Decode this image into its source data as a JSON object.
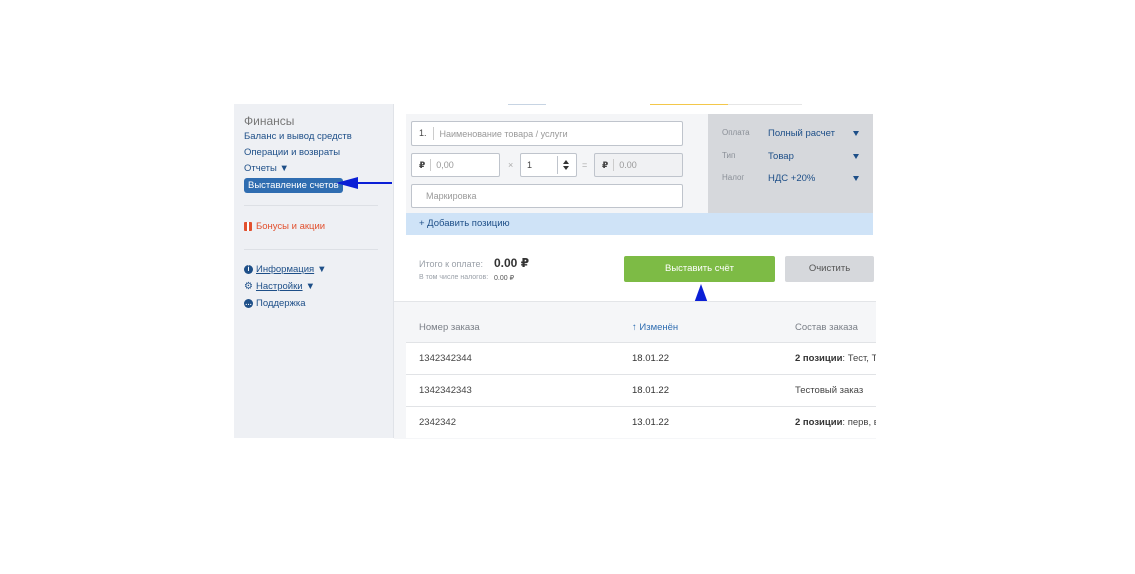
{
  "sidebar": {
    "title": "Финансы",
    "links": [
      {
        "label": "Баланс и вывод средств"
      },
      {
        "label": "Операции и возвраты"
      },
      {
        "label": "Отчеты ▼"
      }
    ],
    "active": "Выставление счетов",
    "bonus": "Бонусы и акции",
    "info": "Информация",
    "settings": "Настройки",
    "support": "Поддержка",
    "caret": "▼"
  },
  "form": {
    "item_number": "1.",
    "name_placeholder": "Наименование товара / услуги",
    "currency": "₽",
    "price_placeholder": "0,00",
    "times": "×",
    "qty": "1",
    "equals": "=",
    "total_value": "0.00",
    "marking_placeholder": "Маркировка",
    "add_position": "+ Добавить позицию"
  },
  "options": {
    "payment_label": "Оплата",
    "payment_value": "Полный расчет",
    "type_label": "Тип",
    "type_value": "Товар",
    "tax_label": "Налог",
    "tax_value": "НДС +20%"
  },
  "summary": {
    "total_label": "Итого к оплате:",
    "total_value": "0.00 ₽",
    "tax_label": "В том числе налогов:",
    "tax_value": "0.00 ₽"
  },
  "actions": {
    "issue": "Выставить счёт",
    "clear": "Очистить"
  },
  "table": {
    "headers": [
      "Номер заказа",
      "↑ Изменён",
      "Состав заказа"
    ],
    "rows": [
      {
        "order": "1342342344",
        "date": "18.01.22",
        "comp_bold": "2 позиции",
        "comp_rest": ": Тест, Тест"
      },
      {
        "order": "1342342343",
        "date": "18.01.22",
        "comp_bold": "",
        "comp_rest": "Тестовый заказ"
      },
      {
        "order": "2342342",
        "date": "13.01.22",
        "comp_bold": "2 позиции",
        "comp_rest": ": перв, вто"
      }
    ]
  },
  "colors": {
    "accent_blue": "#2f6db1",
    "link_blue": "#1e4f88",
    "issue_green": "#7dbb45",
    "bonus_red": "#e2502e",
    "annotation_arrow": "#0b1fd6"
  }
}
